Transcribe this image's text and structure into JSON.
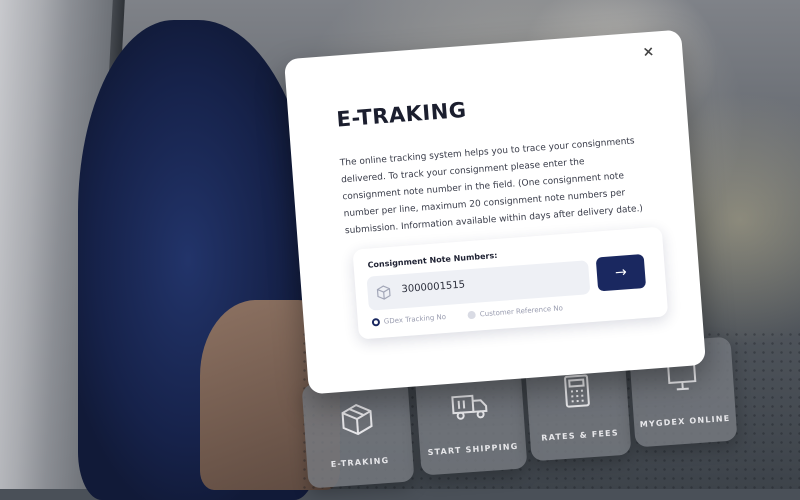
{
  "modal": {
    "close_label": "×",
    "title": "E-TRAKING",
    "description": "The online tracking system helps you to trace your consignments delivered. To track your consignment please enter the consignment note number in the field. (One consignment note number per line, maximum 20 consignment note numbers per submission. Information available within days after delivery date.)",
    "field_label": "Consignment Note Numbers:",
    "input_value": "3000001515",
    "input_icon": "box-icon",
    "submit_icon": "arrow-right-icon",
    "submit_glyph": "→",
    "options": [
      {
        "label": "GDex Tracking No",
        "selected": true
      },
      {
        "label": "Customer Reference No",
        "selected": false
      }
    ],
    "accent_color": "#1a2860"
  },
  "tiles": [
    {
      "label": "E-TRAKING",
      "icon": "box-icon"
    },
    {
      "label": "START SHIPPING",
      "icon": "truck-icon"
    },
    {
      "label": "RATES & FEES",
      "icon": "calculator-icon"
    },
    {
      "label": "MYGDEX ONLINE",
      "icon": "monitor-icon"
    }
  ]
}
